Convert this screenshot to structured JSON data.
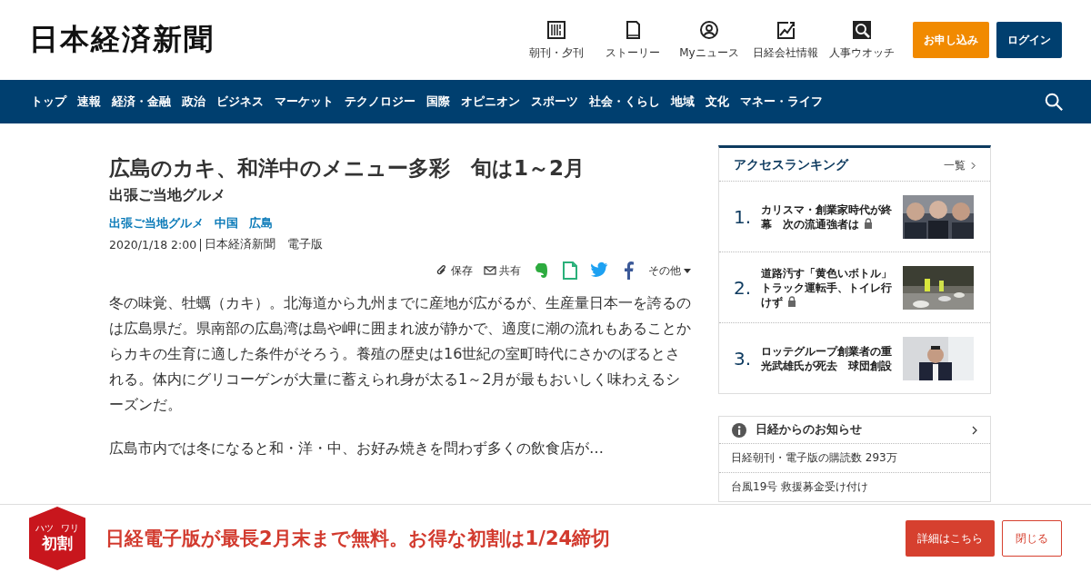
{
  "header": {
    "logo": "日本経済新聞",
    "tools": [
      {
        "kind": "paper",
        "label": "朝刊・夕刊"
      },
      {
        "kind": "book",
        "label": "ストーリー"
      },
      {
        "kind": "person",
        "label": "Myニュース"
      },
      {
        "kind": "chart",
        "label": "日経会社情報"
      },
      {
        "kind": "search",
        "label": "人事ウオッチ"
      }
    ],
    "subscribe_button": "お申し込み",
    "login_button": "ログイン"
  },
  "nav": {
    "items": [
      "トップ",
      "速報",
      "経済・金融",
      "政治",
      "ビジネス",
      "マーケット",
      "テクノロジー",
      "国際",
      "オピニオン",
      "スポーツ",
      "社会・くらし",
      "地域",
      "文化",
      "マネー・ライフ"
    ]
  },
  "article": {
    "title": "広島のカキ、和洋中のメニュー多彩　旬は1～2月",
    "subtitle": "出張ご当地グルメ",
    "tags": [
      "出張ご当地グルメ",
      "中国",
      "広島"
    ],
    "date": "2020/1/18 2:00",
    "source": "日本経済新聞　電子版",
    "share": [
      {
        "kind": "save",
        "label": "保存"
      },
      {
        "kind": "mail",
        "label": "共有"
      },
      {
        "kind": "evernote"
      },
      {
        "kind": "memo"
      },
      {
        "kind": "twitter"
      },
      {
        "kind": "facebook"
      },
      {
        "kind": "more",
        "label": "その他"
      }
    ],
    "paragraphs": [
      "冬の味覚、牡蠣（カキ）。北海道から九州までに産地が広がるが、生産量日本一を誇るのは広島県だ。県南部の広島湾は島や岬に囲まれ波が静かで、適度に潮の流れもあることからカキの生育に適した条件がそろう。養殖の歴史は16世紀の室町時代にさかのぼるとされる。体内にグリコーゲンが大量に蓄えられ身が太る1～2月が最もおいしく味わえるシーズンだ。",
      "広島市内では冬になると和・洋・中、お好み焼きを問わず多くの飲食店が…"
    ]
  },
  "ranking": {
    "title": "アクセスランキング",
    "more_link": "一覧",
    "items": [
      {
        "rank": "1.",
        "title": "カリスマ・創業家時代が終幕　次の流通強者は",
        "locked": true
      },
      {
        "rank": "2.",
        "title": "道路汚す「黄色いボトル」トラック運転手、トイレ行けず",
        "locked": true
      },
      {
        "rank": "3.",
        "title": "ロッテグループ創業者の重光武雄氏が死去　球団創設",
        "locked": false
      }
    ]
  },
  "notices": {
    "title": "日経からのお知らせ",
    "items": [
      "日経朝刊・電子版の購読数 293万",
      "台風19号 救援募金受け付け"
    ]
  },
  "banner": {
    "badge": "初割",
    "badge_ruby": [
      "ハツ",
      "ワリ"
    ],
    "text": "日経電子版が最長2月末まで無料。お得な初割は1/24締切",
    "details_button": "詳細はこちら",
    "close_button": "閉じる"
  }
}
